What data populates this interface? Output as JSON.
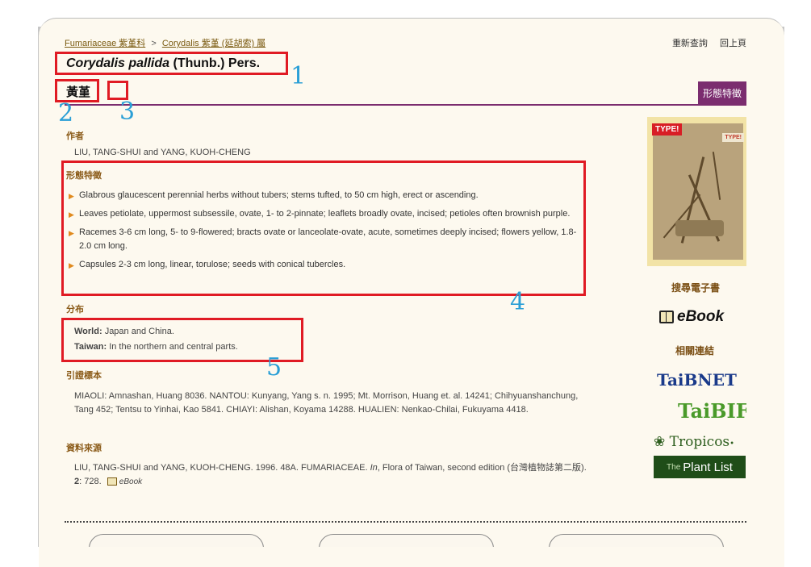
{
  "breadcrumb": {
    "family_link": "Fumariaceae 紫堇科",
    "separator": ">",
    "genus_link": "Corydalis 紫堇 (延胡索) 屬"
  },
  "top_links": {
    "requery": "重新查詢",
    "back": "回上頁"
  },
  "title": {
    "genus_species": "Corydalis pallida",
    "author": "(Thunb.) Pers."
  },
  "chinese_name": "黃堇",
  "tab": {
    "label": "形態特徵"
  },
  "sections": {
    "author": {
      "heading": "作者",
      "text": "LIU, TANG-SHUI and YANG, KUOH-CHENG"
    },
    "morphology": {
      "heading": "形態特徵",
      "items": [
        "Glabrous glaucescent perennial herbs without tubers; stems tufted, to 50 cm high, erect or ascending.",
        "Leaves petiolate, uppermost subsessile, ovate, 1- to 2-pinnate; leaflets broadly ovate, incised; petioles often brownish purple.",
        "Racemes 3-6 cm long, 5- to 9-flowered; bracts ovate or lanceolate-ovate, acute, sometimes deeply incised; flowers yellow, 1.8-2.0 cm long.",
        "Capsules 2-3 cm long, linear, torulose; seeds with conical tubercles."
      ]
    },
    "distribution": {
      "heading": "分布",
      "world_label": "World:",
      "world_text": "Japan and China.",
      "taiwan_label": "Taiwan:",
      "taiwan_text": "In the northern and central parts."
    },
    "specimens": {
      "heading": "引證標本",
      "text": "MIAOLI: Amnashan, Huang 8036. NANTOU: Kunyang, Yang s. n. 1995; Mt. Morrison, Huang et. al. 14241; Chihyuanshanchung, Tang 452; Tentsu to Yinhai, Kao 5841. CHIAYI: Alishan, Koyama 14288. HUALIEN: Nenkao-Chilai, Fukuyama 4418."
    },
    "source": {
      "heading": "資料來源",
      "text_part1": "LIU, TANG-SHUI and YANG, KUOH-CHENG. 1996. 48A. FUMARIACEAE.",
      "in_label": "In",
      "text_part2": ", Flora of Taiwan, second edition (台灣植物誌第二版).",
      "volume": "2",
      "pages": ": 728.",
      "ebook_label": "eBook"
    }
  },
  "sidebar": {
    "type_tag": "TYPE!",
    "type_tag_small": "TYPE!",
    "search_ebook_heading": "搜尋電子書",
    "ebook_label": "eBook",
    "related_links_heading": "相關連結",
    "links": {
      "taibnet": "TaiBNET",
      "taibif": "TaiBIF",
      "tropicos": "Tropicos",
      "plantlist_prefix": "The",
      "plantlist": "Plant List"
    }
  },
  "annotations": [
    "1",
    "2",
    "3",
    "4",
    "5"
  ]
}
